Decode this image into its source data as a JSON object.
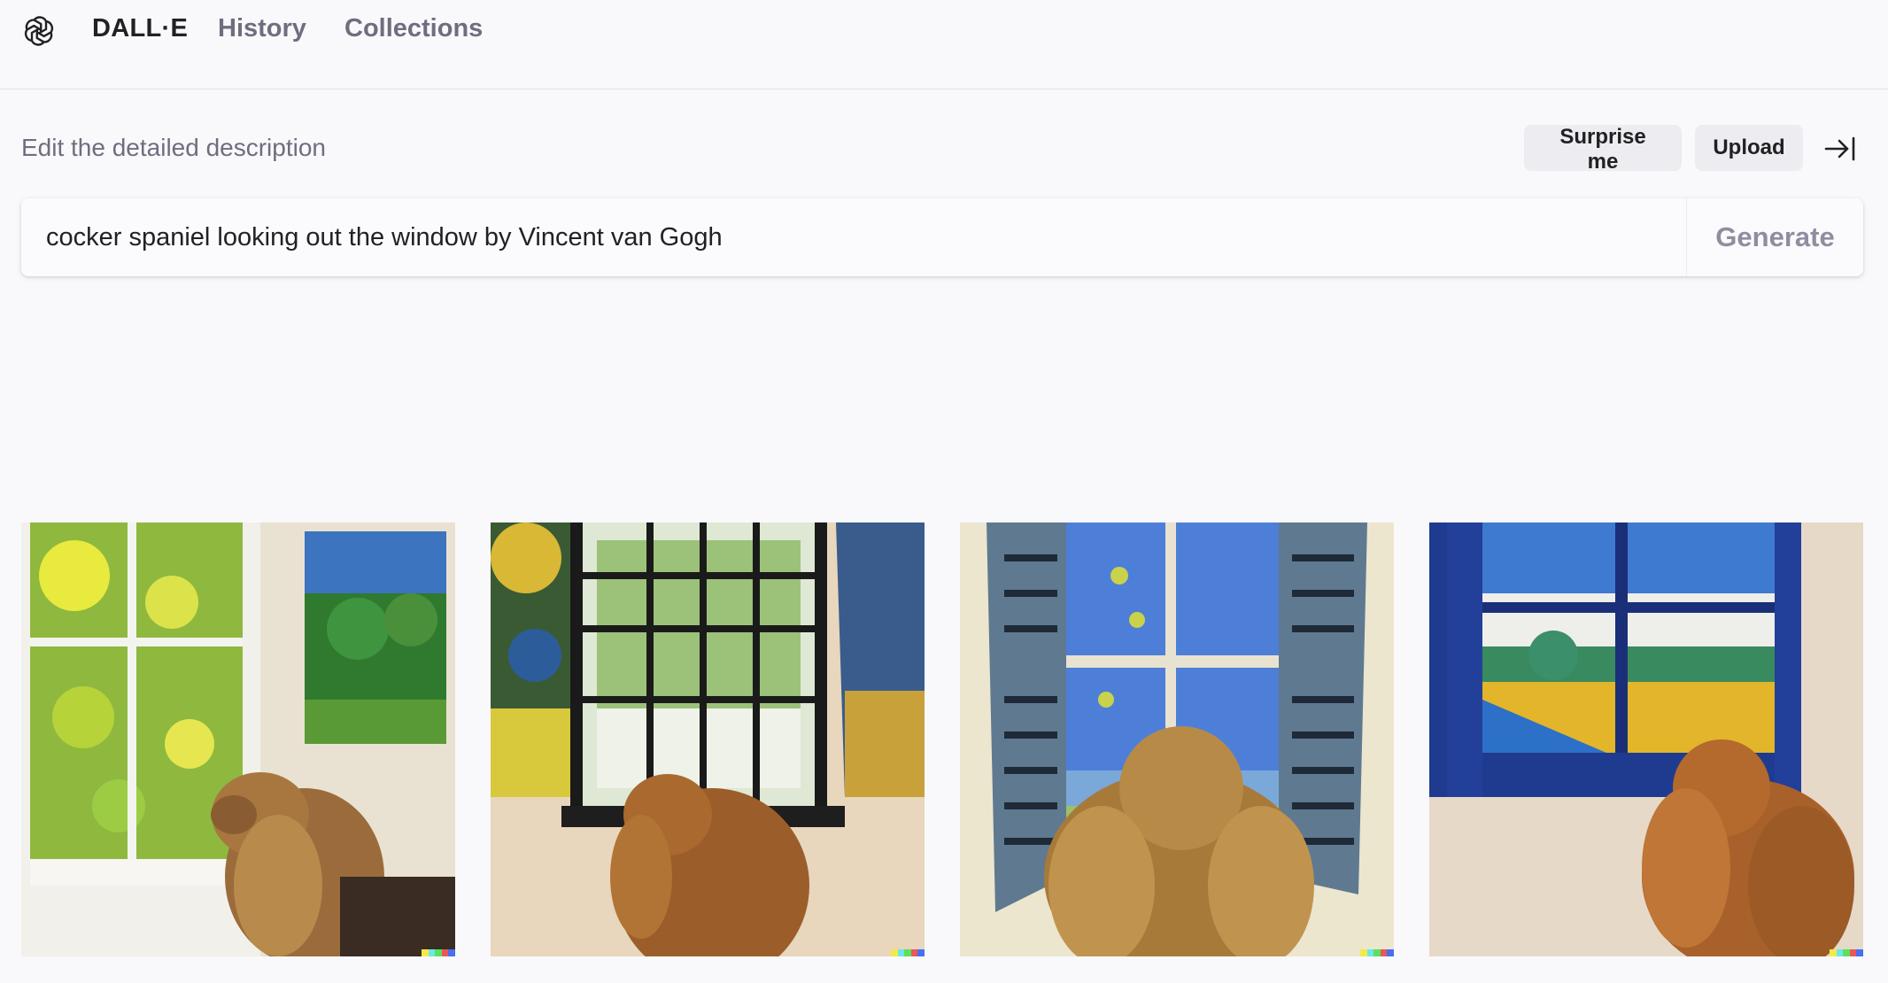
{
  "app": {
    "brand": "DALL·E",
    "nav": {
      "history": "History",
      "collections": "Collections"
    }
  },
  "prompt_bar": {
    "label": "Edit the detailed description",
    "surprise_label": "Surprise me",
    "upload_label": "Upload",
    "value": "cocker spaniel looking out the window by Vincent van Gogh",
    "generate_label": "Generate"
  },
  "icons": {
    "logo": "openai-logo-icon",
    "collapse": "collapse-panel-icon"
  },
  "images": [
    {
      "name": "generated-image-1"
    },
    {
      "name": "generated-image-2"
    },
    {
      "name": "generated-image-3"
    },
    {
      "name": "generated-image-4"
    }
  ],
  "colors": {
    "background": "#f9f9fb",
    "text": "#202123",
    "muted": "#6e6e80",
    "button_bg": "#ececf1",
    "signature": [
      "#f5e94a",
      "#6fe6e6",
      "#5be05b",
      "#e85858",
      "#4a6ef0"
    ]
  }
}
